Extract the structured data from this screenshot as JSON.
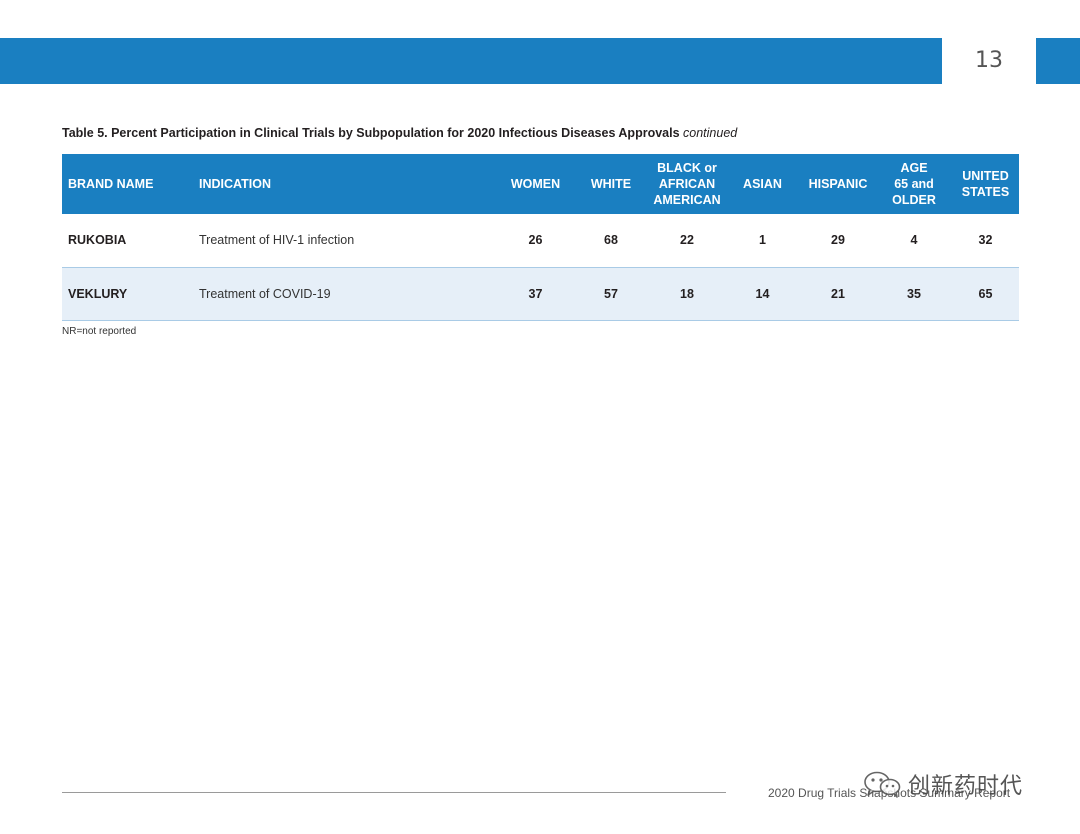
{
  "header": {
    "page_number": "13"
  },
  "table": {
    "caption": "Table 5. Percent Participation in Clinical Trials by Subpopulation for 2020 Infectious Diseases Approvals",
    "caption_suffix": "continued",
    "columns": [
      {
        "label": "BRAND NAME"
      },
      {
        "label": "INDICATION"
      },
      {
        "line1": "WOMEN"
      },
      {
        "line1": "WHITE"
      },
      {
        "line1": "BLACK or",
        "line2": "AFRICAN",
        "line3": "AMERICAN"
      },
      {
        "line1": "ASIAN"
      },
      {
        "line1": "HISPANIC"
      },
      {
        "line1": "AGE",
        "line2": "65 and",
        "line3": "OLDER"
      },
      {
        "line1": "UNITED",
        "line2": "STATES"
      }
    ],
    "rows": [
      {
        "brand": "RUKOBIA",
        "indication": "Treatment of HIV-1 infection",
        "women": "26",
        "white": "68",
        "black": "22",
        "asian": "1",
        "hispanic": "29",
        "age65": "4",
        "us": "32"
      },
      {
        "brand": "VEKLURY",
        "indication": "Treatment of COVID-19",
        "women": "37",
        "white": "57",
        "black": "18",
        "asian": "14",
        "hispanic": "21",
        "age65": "35",
        "us": "65"
      }
    ],
    "footnote": "NR=not reported"
  },
  "footer": {
    "text": "2020 Drug Trials Snapshots Summary Report"
  },
  "watermark": {
    "text": "创新药时代",
    "icon": "wechat-icon"
  }
}
